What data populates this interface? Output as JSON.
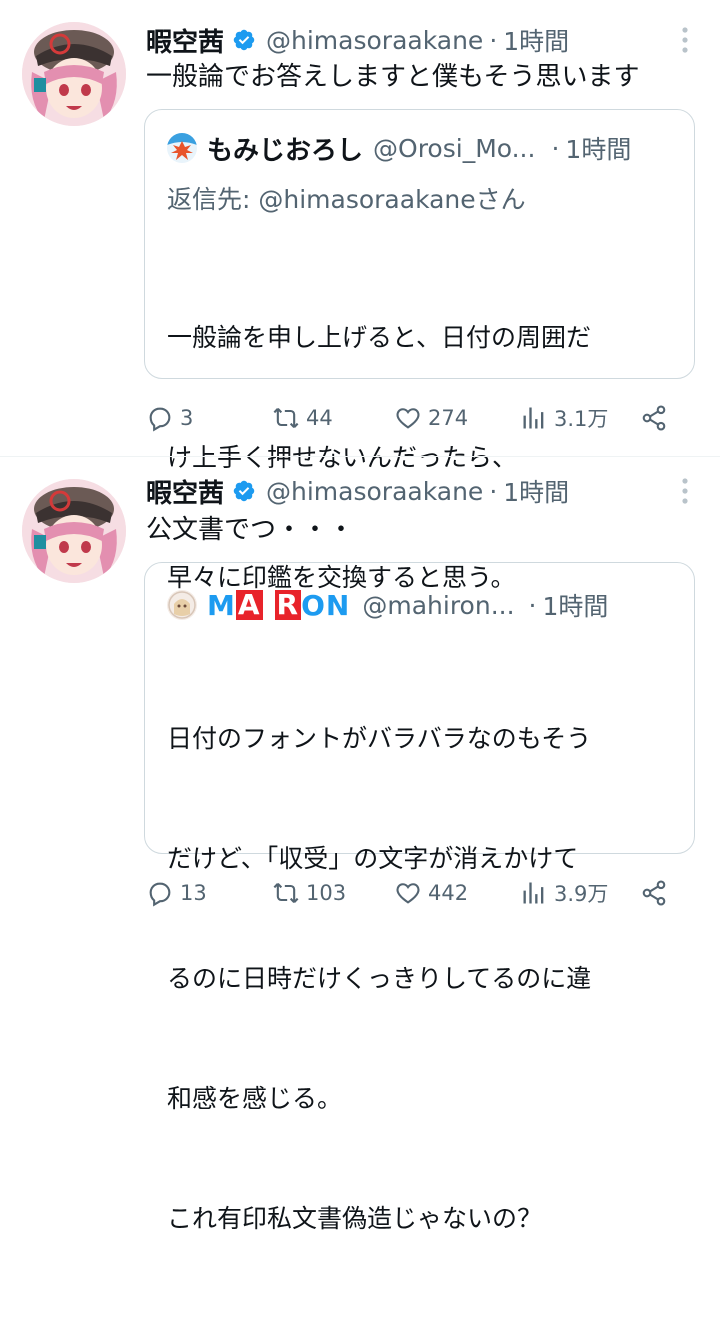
{
  "tweets": [
    {
      "author": "暇空茜",
      "handle": "@himasoraakane",
      "sep": "·",
      "time": "1時間",
      "text": "一般論でお答えしますと僕もそう思います",
      "quote": {
        "name": "もみじおろし",
        "handle": "@Orosi_Mo...",
        "sep": "·",
        "time": "1時間",
        "reply_prefix": "返信先: ",
        "reply_account": "@himasoraakane",
        "reply_suffix": "さん",
        "lines": [
          "一般論を申し上げると、日付の周囲だ",
          "け上手く押せないんだったら、",
          "早々に印鑑を交換すると思う。"
        ]
      },
      "actions": {
        "replies": "3",
        "retweets": "44",
        "likes": "274",
        "views": "3.1万"
      }
    },
    {
      "author": "暇空茜",
      "handle": "@himasoraakane",
      "sep": "·",
      "time": "1時間",
      "text": "公文書でつ・・・",
      "quote": {
        "name_parts": [
          "M",
          "A",
          " ",
          "R",
          "O",
          "N"
        ],
        "handle": "@mahiron...",
        "sep": "·",
        "time": "1時間",
        "lines": [
          "日付のフォントがバラバラなのもそう",
          "だけど、「収受」の文字が消えかけて",
          "るのに日時だけくっきりしてるのに違",
          "和感を感じる。",
          "これ有印私文書偽造じゃないの？"
        ]
      },
      "actions": {
        "replies": "13",
        "retweets": "103",
        "likes": "442",
        "views": "3.9万"
      }
    }
  ],
  "icons": [
    "verified-badge-icon",
    "more-icon",
    "reply-icon",
    "retweet-icon",
    "like-icon",
    "views-icon",
    "share-icon"
  ],
  "colors": {
    "verified": "#1d9bf0",
    "secondary": "#536471",
    "border": "#cfd9de",
    "maron_red": "#e8232a"
  }
}
